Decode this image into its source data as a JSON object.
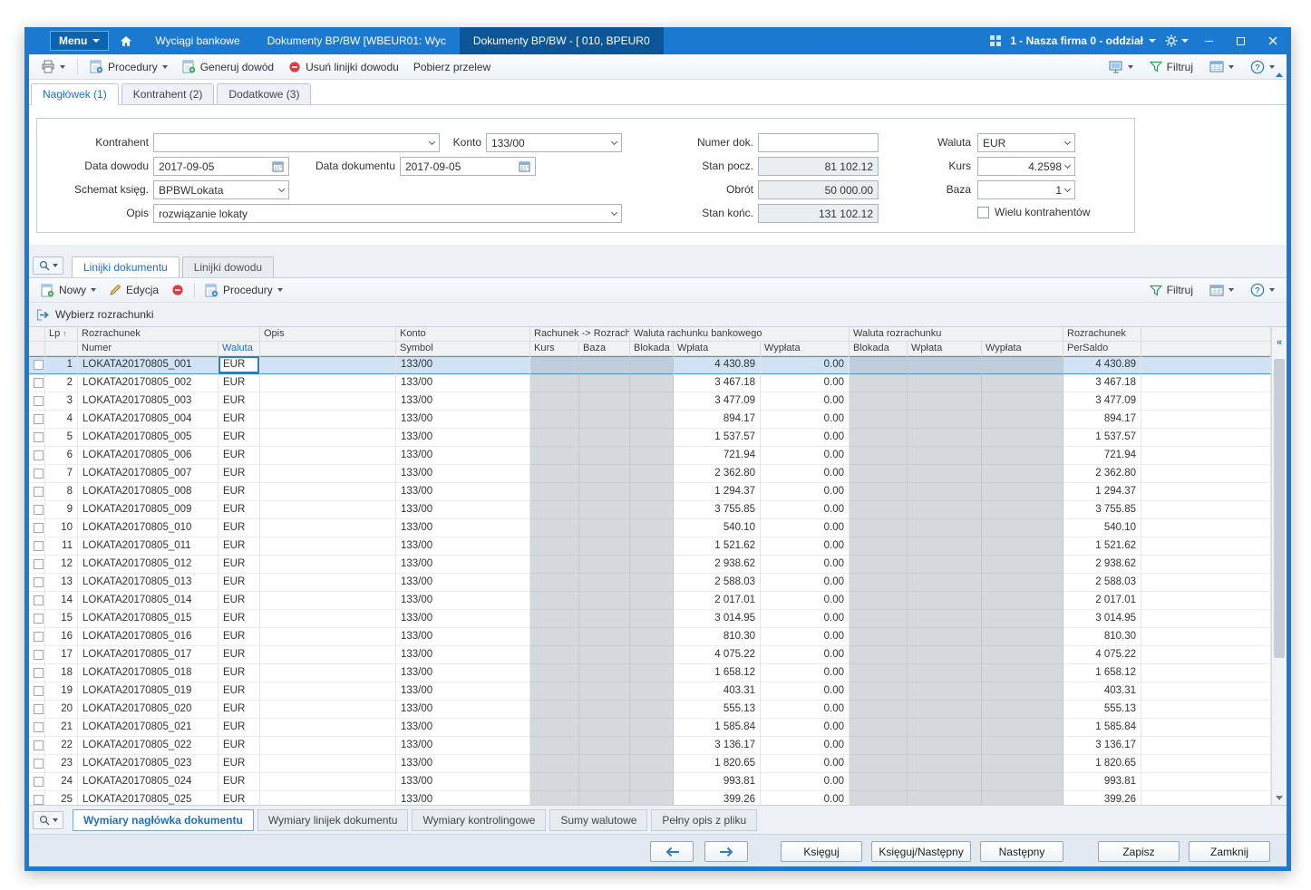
{
  "titlebar": {
    "menu": "Menu",
    "tabs": [
      {
        "label": "Wyciągi bankowe"
      },
      {
        "label": "Dokumenty BP/BW [WBEUR01: Wyc"
      },
      {
        "label": "Dokumenty BP/BW - [ 010, BPEUR0"
      }
    ],
    "company": "1 - Nasza firma 0 - oddział"
  },
  "toolbar": {
    "procedury": "Procedury",
    "generuj_dowod": "Generuj dowód",
    "usun_linijki_dowodu": "Usuń linijki dowodu",
    "pobierz_przelew": "Pobierz przelew",
    "filtruj": "Filtruj"
  },
  "header_tabs": [
    {
      "label": "Nagłówek (1)"
    },
    {
      "label": "Kontrahent (2)"
    },
    {
      "label": "Dodatkowe (3)"
    }
  ],
  "form": {
    "kontrahent_label": "Kontrahent",
    "kontrahent_value": "",
    "konto_label": "Konto",
    "konto_value": "133/00",
    "numer_dok_label": "Numer dok.",
    "numer_dok_value": "",
    "waluta_label": "Waluta",
    "waluta_value": "EUR",
    "data_dowodu_label": "Data dowodu",
    "data_dowodu_value": "2017-09-05",
    "data_dokumentu_label": "Data dokumentu",
    "data_dokumentu_value": "2017-09-05",
    "stan_pocz_label": "Stan pocz.",
    "stan_pocz_value": "81 102.12",
    "kurs_label": "Kurs",
    "kurs_value": "4.2598",
    "schemat_label": "Schemat księg.",
    "schemat_value": "BPBWLokata",
    "obrot_label": "Obrót",
    "obrot_value": "50 000.00",
    "baza_label": "Baza",
    "baza_value": "1",
    "opis_label": "Opis",
    "opis_value": "rozwiązanie lokaty",
    "stan_konc_label": "Stan końc.",
    "stan_konc_value": "131 102.12",
    "wielu_kontrahentow_label": "Wielu kontrahentów"
  },
  "lines": {
    "tabs": [
      {
        "label": "Linijki dokumentu"
      },
      {
        "label": "Linijki dowodu"
      }
    ],
    "nowy": "Nowy",
    "edycja": "Edycja",
    "procedury": "Procedury",
    "filtruj": "Filtruj",
    "wybierz_rozrachunki": "Wybierz rozrachunki"
  },
  "table": {
    "groups": {
      "lp": "Lp",
      "rozrachunek": "Rozrachunek",
      "opis": "Opis",
      "konto": "Konto",
      "rach_rozrach": "Rachunek -> Rozrachu",
      "waluta_rachunku": "Waluta rachunku bankowego",
      "waluta_rozrachunku": "Waluta rozrachunku",
      "rozrachunek2": "Rozrachunek"
    },
    "cols": {
      "numer": "Numer",
      "waluta": "Waluta",
      "symbol": "Symbol",
      "kurs": "Kurs",
      "baza": "Baza",
      "blokada": "Blokada",
      "wplata": "Wpłata",
      "wyplata": "Wypłata",
      "blokada2": "Blokada",
      "wplata2": "Wpłata",
      "wyplata2": "Wypłata",
      "persaldo": "PerSaldo"
    },
    "rows": [
      {
        "lp": "1",
        "numer": "LOKATA20170805_001",
        "waluta": "EUR",
        "symbol": "133/00",
        "wplata": "4 430.89",
        "wyplata": "0.00",
        "persaldo": "4 430.89",
        "selected": true
      },
      {
        "lp": "2",
        "numer": "LOKATA20170805_002",
        "waluta": "EUR",
        "symbol": "133/00",
        "wplata": "3 467.18",
        "wyplata": "0.00",
        "persaldo": "3 467.18"
      },
      {
        "lp": "3",
        "numer": "LOKATA20170805_003",
        "waluta": "EUR",
        "symbol": "133/00",
        "wplata": "3 477.09",
        "wyplata": "0.00",
        "persaldo": "3 477.09"
      },
      {
        "lp": "4",
        "numer": "LOKATA20170805_004",
        "waluta": "EUR",
        "symbol": "133/00",
        "wplata": "894.17",
        "wyplata": "0.00",
        "persaldo": "894.17"
      },
      {
        "lp": "5",
        "numer": "LOKATA20170805_005",
        "waluta": "EUR",
        "symbol": "133/00",
        "wplata": "1 537.57",
        "wyplata": "0.00",
        "persaldo": "1 537.57"
      },
      {
        "lp": "6",
        "numer": "LOKATA20170805_006",
        "waluta": "EUR",
        "symbol": "133/00",
        "wplata": "721.94",
        "wyplata": "0.00",
        "persaldo": "721.94"
      },
      {
        "lp": "7",
        "numer": "LOKATA20170805_007",
        "waluta": "EUR",
        "symbol": "133/00",
        "wplata": "2 362.80",
        "wyplata": "0.00",
        "persaldo": "2 362.80"
      },
      {
        "lp": "8",
        "numer": "LOKATA20170805_008",
        "waluta": "EUR",
        "symbol": "133/00",
        "wplata": "1 294.37",
        "wyplata": "0.00",
        "persaldo": "1 294.37"
      },
      {
        "lp": "9",
        "numer": "LOKATA20170805_009",
        "waluta": "EUR",
        "symbol": "133/00",
        "wplata": "3 755.85",
        "wyplata": "0.00",
        "persaldo": "3 755.85"
      },
      {
        "lp": "10",
        "numer": "LOKATA20170805_010",
        "waluta": "EUR",
        "symbol": "133/00",
        "wplata": "540.10",
        "wyplata": "0.00",
        "persaldo": "540.10"
      },
      {
        "lp": "11",
        "numer": "LOKATA20170805_011",
        "waluta": "EUR",
        "symbol": "133/00",
        "wplata": "1 521.62",
        "wyplata": "0.00",
        "persaldo": "1 521.62"
      },
      {
        "lp": "12",
        "numer": "LOKATA20170805_012",
        "waluta": "EUR",
        "symbol": "133/00",
        "wplata": "2 938.62",
        "wyplata": "0.00",
        "persaldo": "2 938.62"
      },
      {
        "lp": "13",
        "numer": "LOKATA20170805_013",
        "waluta": "EUR",
        "symbol": "133/00",
        "wplata": "2 588.03",
        "wyplata": "0.00",
        "persaldo": "2 588.03"
      },
      {
        "lp": "14",
        "numer": "LOKATA20170805_014",
        "waluta": "EUR",
        "symbol": "133/00",
        "wplata": "2 017.01",
        "wyplata": "0.00",
        "persaldo": "2 017.01"
      },
      {
        "lp": "15",
        "numer": "LOKATA20170805_015",
        "waluta": "EUR",
        "symbol": "133/00",
        "wplata": "3 014.95",
        "wyplata": "0.00",
        "persaldo": "3 014.95"
      },
      {
        "lp": "16",
        "numer": "LOKATA20170805_016",
        "waluta": "EUR",
        "symbol": "133/00",
        "wplata": "810.30",
        "wyplata": "0.00",
        "persaldo": "810.30"
      },
      {
        "lp": "17",
        "numer": "LOKATA20170805_017",
        "waluta": "EUR",
        "symbol": "133/00",
        "wplata": "4 075.22",
        "wyplata": "0.00",
        "persaldo": "4 075.22"
      },
      {
        "lp": "18",
        "numer": "LOKATA20170805_018",
        "waluta": "EUR",
        "symbol": "133/00",
        "wplata": "1 658.12",
        "wyplata": "0.00",
        "persaldo": "1 658.12"
      },
      {
        "lp": "19",
        "numer": "LOKATA20170805_019",
        "waluta": "EUR",
        "symbol": "133/00",
        "wplata": "403.31",
        "wyplata": "0.00",
        "persaldo": "403.31"
      },
      {
        "lp": "20",
        "numer": "LOKATA20170805_020",
        "waluta": "EUR",
        "symbol": "133/00",
        "wplata": "555.13",
        "wyplata": "0.00",
        "persaldo": "555.13"
      },
      {
        "lp": "21",
        "numer": "LOKATA20170805_021",
        "waluta": "EUR",
        "symbol": "133/00",
        "wplata": "1 585.84",
        "wyplata": "0.00",
        "persaldo": "1 585.84"
      },
      {
        "lp": "22",
        "numer": "LOKATA20170805_022",
        "waluta": "EUR",
        "symbol": "133/00",
        "wplata": "3 136.17",
        "wyplata": "0.00",
        "persaldo": "3 136.17"
      },
      {
        "lp": "23",
        "numer": "LOKATA20170805_023",
        "waluta": "EUR",
        "symbol": "133/00",
        "wplata": "1 820.65",
        "wyplata": "0.00",
        "persaldo": "1 820.65"
      },
      {
        "lp": "24",
        "numer": "LOKATA20170805_024",
        "waluta": "EUR",
        "symbol": "133/00",
        "wplata": "993.81",
        "wyplata": "0.00",
        "persaldo": "993.81"
      },
      {
        "lp": "25",
        "numer": "LOKATA20170805_025",
        "waluta": "EUR",
        "symbol": "133/00",
        "wplata": "399.26",
        "wyplata": "0.00",
        "persaldo": "399.26"
      }
    ]
  },
  "bottom_tabs": [
    {
      "label": "Wymiary nagłówka dokumentu"
    },
    {
      "label": "Wymiary linijek dokumentu"
    },
    {
      "label": "Wymiary kontrolingowe"
    },
    {
      "label": "Sumy walutowe"
    },
    {
      "label": "Pełny opis z pliku"
    }
  ],
  "footer": {
    "ksieguj": "Księguj",
    "ksieguj_nastepny": "Księguj/Następny",
    "nastepny": "Następny",
    "zapisz": "Zapisz",
    "zamknij": "Zamknij"
  }
}
